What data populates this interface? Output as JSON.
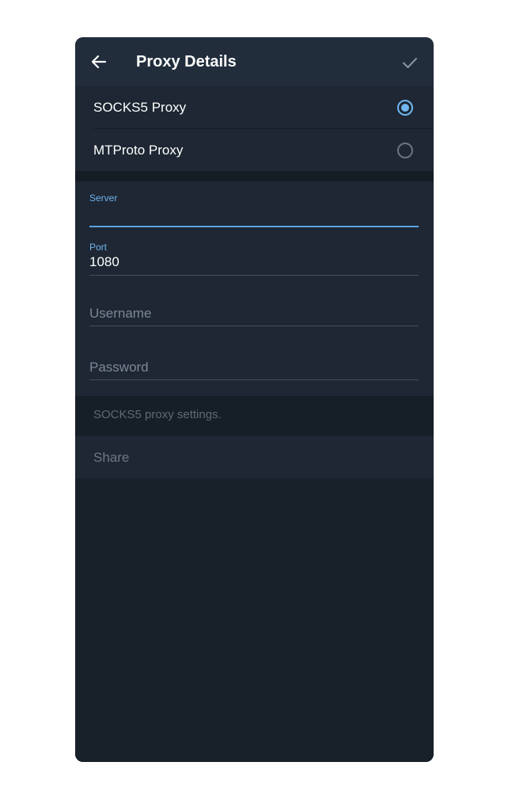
{
  "header": {
    "title": "Proxy Details",
    "back_icon": "arrow-left-icon",
    "done_icon": "check-icon"
  },
  "proxy_types": [
    {
      "label": "SOCKS5 Proxy",
      "selected": true
    },
    {
      "label": "MTProto Proxy",
      "selected": false
    }
  ],
  "fields": {
    "server": {
      "label": "Server",
      "value": "",
      "focused": true
    },
    "port": {
      "label": "Port",
      "value": "1080"
    },
    "username": {
      "placeholder": "Username",
      "value": ""
    },
    "password": {
      "placeholder": "Password",
      "value": ""
    }
  },
  "info": {
    "text": "SOCKS5 proxy settings."
  },
  "share": {
    "label": "Share"
  },
  "colors": {
    "accent": "#5ca4e2",
    "background": "#18202a",
    "surface": "#1e2733",
    "header": "#212d3b"
  }
}
